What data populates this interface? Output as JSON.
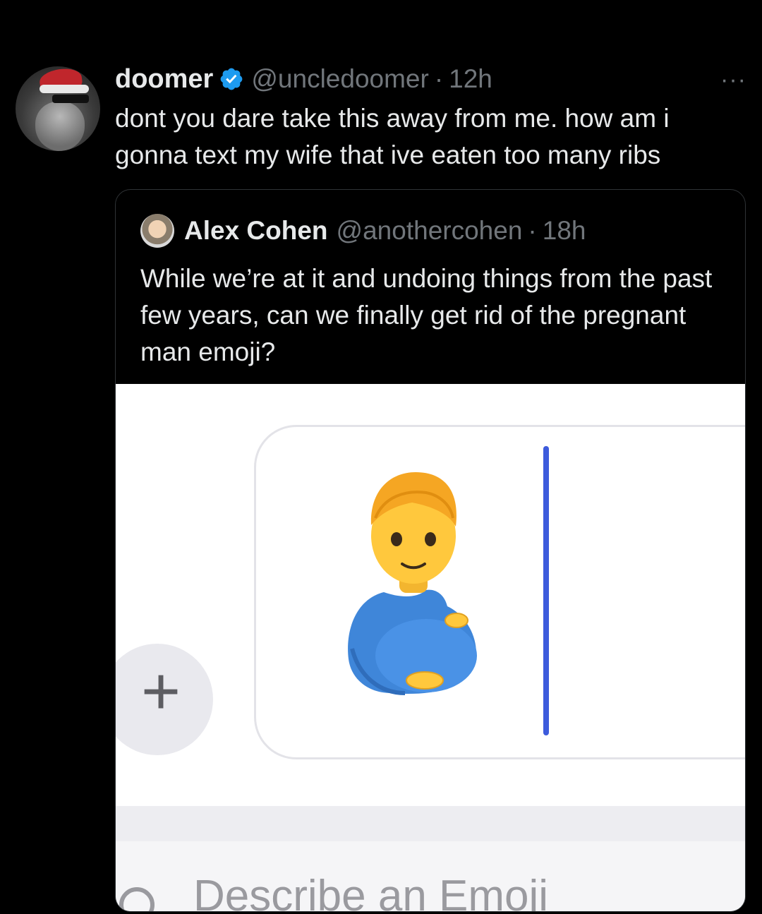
{
  "tweet": {
    "display_name": "doomer",
    "handle": "@uncledoomer",
    "separator": "·",
    "time": "12h",
    "more_label": "···",
    "text": "dont you dare take this away from me. how am i gonna text my wife that ive eaten too many ribs"
  },
  "quote": {
    "display_name": "Alex Cohen",
    "handle": "@anothercohen",
    "separator": "·",
    "time": "18h",
    "text": "While we’re at it and undoing things from the past few years, can we finally get rid of the pregnant man emoji?"
  },
  "media": {
    "plus_label": "+",
    "emoji_icon": "pregnant-man-emoji",
    "search_placeholder": "Describe an Emoji",
    "colors": {
      "cursor": "#3d5bdc",
      "shirt": "#3f86d9",
      "skin": "#ffc83d"
    }
  },
  "colors": {
    "background": "#000000",
    "text_primary": "#e7e9ea",
    "text_secondary": "#71767b",
    "verified": "#1d9bf0"
  }
}
